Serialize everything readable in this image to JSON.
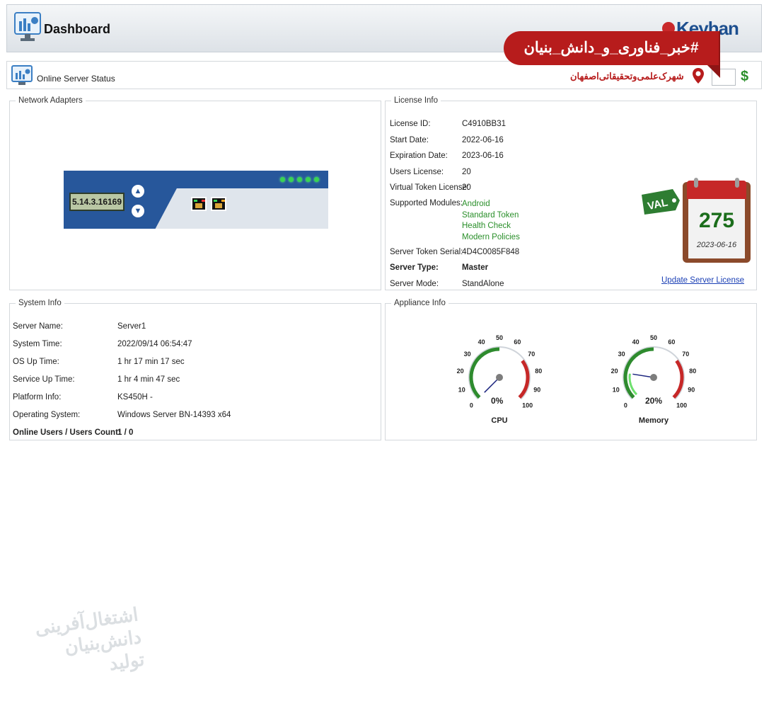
{
  "header": {
    "title": "Dashboard",
    "brand": "Keyhan"
  },
  "status_bar": {
    "title": "Online Server Status"
  },
  "network": {
    "legend": "Network Adapters",
    "adapter_ip": "5.14.3.16169",
    "up_arrow": "▲",
    "down_arrow": "▼"
  },
  "license": {
    "legend": "License Info",
    "rows": [
      {
        "label": "License ID:",
        "value": "C4910BB31"
      },
      {
        "label": "Start Date:",
        "value": "2022-06-16"
      },
      {
        "label": "Expiration Date:",
        "value": "2023-06-16"
      },
      {
        "label": "Users License:",
        "value": "20"
      },
      {
        "label": "Virtual Token License:",
        "value": "20"
      },
      {
        "label": "Supported Modules:",
        "value": ""
      },
      {
        "label": "Server Token Serial:",
        "value": "4D4C0085F848"
      },
      {
        "label": "Server Type:",
        "value": "Master"
      },
      {
        "label": "Server Mode:",
        "value": "StandAlone"
      }
    ],
    "modules": [
      "Android",
      "Standard Token",
      "Health Check",
      "Modern Policies"
    ],
    "update_link": "Update Server License",
    "calendar_days": "275",
    "calendar_date": "2023-06-16",
    "val_tag": "VAL"
  },
  "system": {
    "legend": "System Info",
    "rows": [
      {
        "label": "Server Name:",
        "value": "Server1"
      },
      {
        "label": "System Time:",
        "value": "2022/09/14 06:54:47"
      },
      {
        "label": "OS Up Time:",
        "value": "1 hr 17 min 17 sec"
      },
      {
        "label": "Service Up Time:",
        "value": "1 hr 4 min 47 sec"
      },
      {
        "label": "Platform Info:",
        "value": "KS450H -"
      },
      {
        "label": "Operating System:",
        "value": "Windows Server  BN-14393 x64"
      },
      {
        "label": "Online Users / Users Count:",
        "value": "1 / 0"
      }
    ]
  },
  "appliance": {
    "legend": "Appliance Info",
    "ticks": [
      "0",
      "10",
      "20",
      "30",
      "40",
      "50",
      "60",
      "70",
      "80",
      "90",
      "100"
    ],
    "gauges": [
      {
        "name": "CPU",
        "value": 0,
        "display": "0%"
      },
      {
        "name": "Memory",
        "value": 20,
        "display": "20%"
      }
    ]
  },
  "overlay": {
    "banner": "#خبر_فناوری_و_دانش_بنیان",
    "location": "شهرک‌علمی‌وتحقیقاتی‌اصفهان"
  },
  "colors": {
    "brand_red": "#b71c1c",
    "device_blue": "#27579b",
    "module_green": "#2a8f2a",
    "link_blue": "#1a3fb5"
  }
}
